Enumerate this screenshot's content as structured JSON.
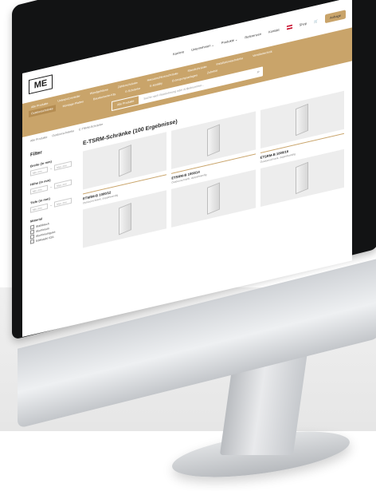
{
  "header": {
    "logo_text": "ME",
    "nav": [
      "Karriere",
      "Unternehmen ⌄",
      "Produkte ⌄",
      "Referenzen",
      "Kontakt"
    ],
    "cart_label": "Shop",
    "contact_button": "Anfrage"
  },
  "categories": {
    "row1": [
      "Alle Produkte",
      "Unterputzverteiler",
      "Wandgehäuse",
      "Zählerschränke",
      "Hausanschlussschränke",
      "Standschränke",
      "Installationsschränke",
      "Verteilertechnik"
    ],
    "row2": [
      "Outdoorschränke",
      "Montage-Platten",
      "Bauelemente-Kits",
      "E-Schränke",
      "E-Mobility",
      "Erzeugungsanlagen",
      "Zubehör"
    ],
    "active": "Outdoorschränke"
  },
  "search": {
    "category": "Alle Produkte",
    "placeholder": "Suche nach Bezeichnung oder Artikelnummer..."
  },
  "breadcrumb": [
    "Alle Produkte",
    "Outdoorschränke",
    "E-TSRM-Schränke"
  ],
  "filters": {
    "title": "Filter",
    "width_label": "Breite (in mm)",
    "height_label": "Höhe (in mm)",
    "depth_label": "Tiefe (in mm)",
    "min_placeholder": "Min. mm",
    "max_placeholder": "Max. mm",
    "material_label": "Material",
    "materials": [
      "Stahlblech",
      "Aluminium",
      "Aluminiumguss",
      "Edelstahl V2A"
    ]
  },
  "results": {
    "title": "E-TSRM-Schränke (100 Ergebnisse)",
    "products": [
      {
        "name": "ETSRM-B 1000/12",
        "desc": "Outdoorschrank, doppelwandig"
      },
      {
        "name": "ETSRM-B 1000/14",
        "desc": "Outdoorschrank, doppelwandig"
      },
      {
        "name": "ETSRM-B 1000/16",
        "desc": "Outdoorschrank, doppelwandig"
      },
      {
        "name": "",
        "desc": ""
      },
      {
        "name": "",
        "desc": ""
      },
      {
        "name": "",
        "desc": ""
      }
    ]
  },
  "colors": {
    "brand": "#c9a46a",
    "bezel": "#121314"
  }
}
